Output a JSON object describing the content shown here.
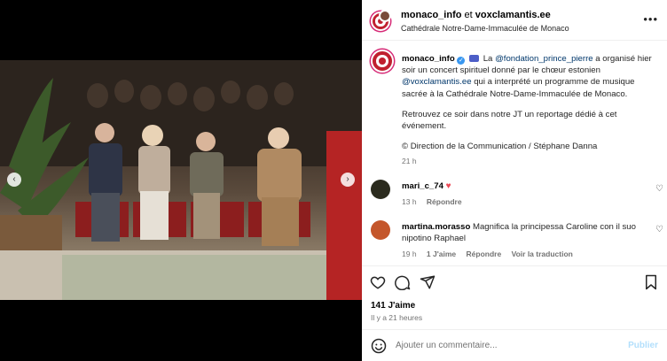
{
  "post": {
    "author": "monaco_info",
    "collaborator_joiner": "et",
    "collaborator": "voxclamantis.ee",
    "location": "Cathédrale Notre-Dame-Immaculée de Monaco"
  },
  "caption": {
    "author": "monaco_info",
    "intro": "La",
    "mention1": "@fondation_prince_pierre",
    "text1": "a organisé hier soir un concert spirituel donné par le chœur estonien",
    "mention2": "@voxclamantis.ee",
    "text2": "qui a interprété un programme de musique sacrée à la Cathédrale Notre-Dame-Immaculée de Monaco.",
    "para2": "Retrouvez ce soir dans notre JT un reportage dédié à cet événement.",
    "para3": "© Direction de la Communication / Stéphane Danna",
    "time": "21 h"
  },
  "comments": [
    {
      "user": "mari_c_74",
      "text": "",
      "time": "13 h",
      "reply": "Répondre",
      "avatar_color": "#2b2b1e"
    },
    {
      "user": "martina.morasso",
      "text": "Magnifica la principessa Caroline con il suo nipotino Raphael",
      "time": "19 h",
      "likes": "1 J'aime",
      "reply": "Répondre",
      "translate": "Voir la traduction",
      "avatar_color": "#c4562b"
    }
  ],
  "footer": {
    "likes": "141 J'aime",
    "ago": "Il y a 21 heures",
    "comment_placeholder": "Ajouter un commentaire...",
    "publish": "Publier"
  },
  "icons": {
    "prev": "chevron-left-icon",
    "next": "chevron-right-icon",
    "more": "more-icon",
    "like": "heart-icon",
    "comment": "comment-icon",
    "share": "paper-plane-icon",
    "save": "bookmark-icon",
    "emoji": "smiley-icon"
  }
}
